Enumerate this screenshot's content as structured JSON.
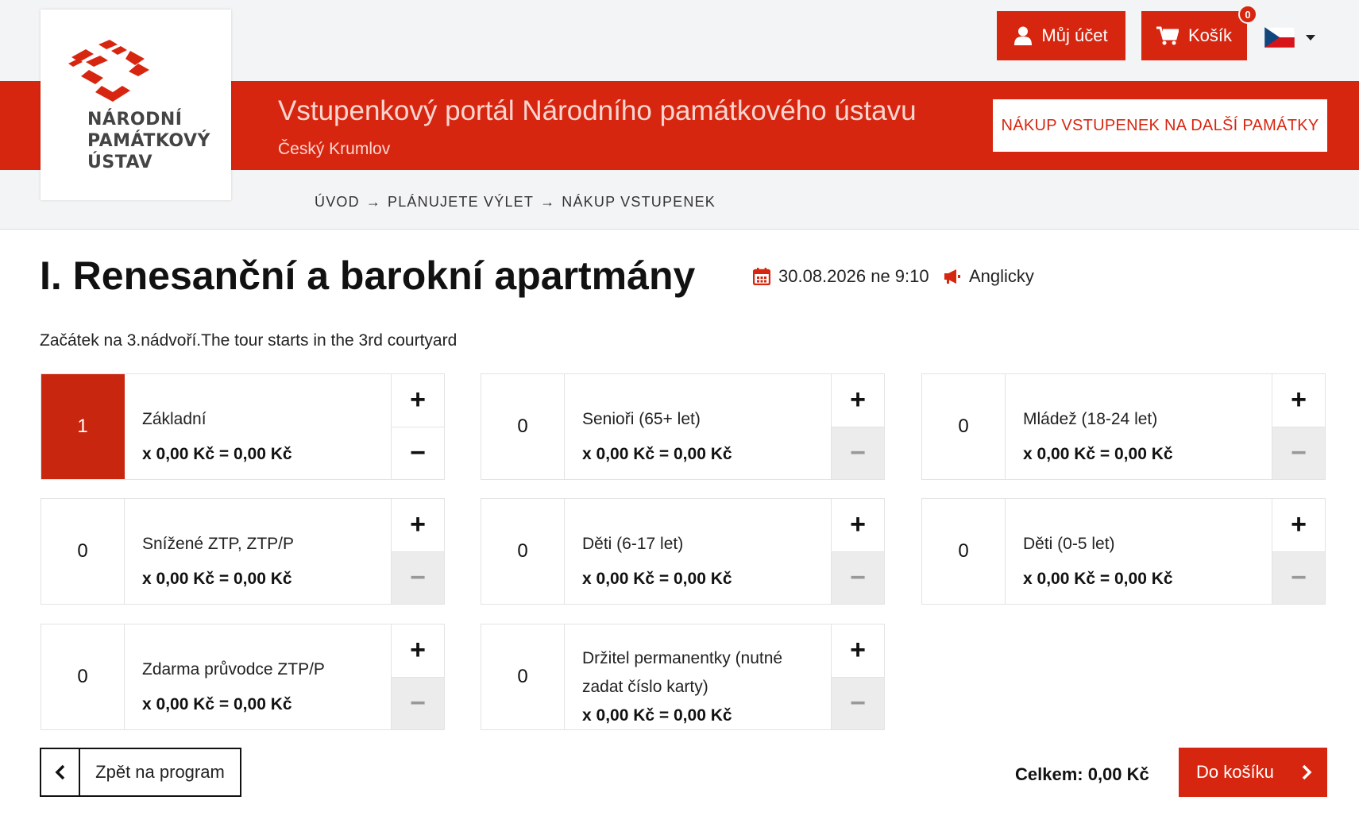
{
  "header": {
    "logo_text": "NÁRODNÍ\nPAMÁTKOVÝ\nÚSTAV",
    "account_label": "Můj účet",
    "cart_label": "Košík",
    "cart_count": "0",
    "language_icon": "czech-flag-icon"
  },
  "banner": {
    "title": "Vstupenkový portál Národního památkového ústavu",
    "subtitle": "Český Krumlov",
    "other_monuments_label": "NÁKUP VSTUPENEK NA DALŠÍ PAMÁTKY"
  },
  "breadcrumb": {
    "items": [
      "ÚVOD",
      "PLÁNUJETE VÝLET",
      "NÁKUP VSTUPENEK"
    ],
    "separator": "→"
  },
  "tour": {
    "title": "I. Renesanční a barokní apartmány",
    "datetime": "30.08.2026 ne 9:10",
    "language": "Anglicky",
    "description": "Začátek na 3.nádvoří.The tour starts in the 3rd courtyard"
  },
  "tickets": [
    {
      "name": "Základní",
      "price": "x 0,00 Kč = 0,00 Kč",
      "count": "1"
    },
    {
      "name": "Senioři (65+ let)",
      "price": "x 0,00 Kč = 0,00 Kč",
      "count": "0"
    },
    {
      "name": "Mládež (18-24 let)",
      "price": "x 0,00 Kč = 0,00 Kč",
      "count": "0"
    },
    {
      "name": "Snížené ZTP, ZTP/P",
      "price": "x 0,00 Kč = 0,00 Kč",
      "count": "0"
    },
    {
      "name": "Děti (6-17 let)",
      "price": "x 0,00 Kč = 0,00 Kč",
      "count": "0"
    },
    {
      "name": "Děti (0-5 let)",
      "price": "x 0,00 Kč = 0,00 Kč",
      "count": "0"
    },
    {
      "name": "Zdarma průvodce ZTP/P",
      "price": "x 0,00 Kč = 0,00 Kč",
      "count": "0"
    },
    {
      "name": "Držitel permanentky (nutné zadat číslo karty)",
      "price": "x 0,00 Kč = 0,00 Kč",
      "count": "0"
    }
  ],
  "ticket_controls": {
    "plus": "+",
    "minus": "−"
  },
  "footer": {
    "back_label": "Zpět na program",
    "total_label": "Celkem: 0,00 Kč",
    "to_cart_label": "Do košíku"
  },
  "colors": {
    "accent": "#d7260f",
    "background": "#f3f4f5"
  }
}
